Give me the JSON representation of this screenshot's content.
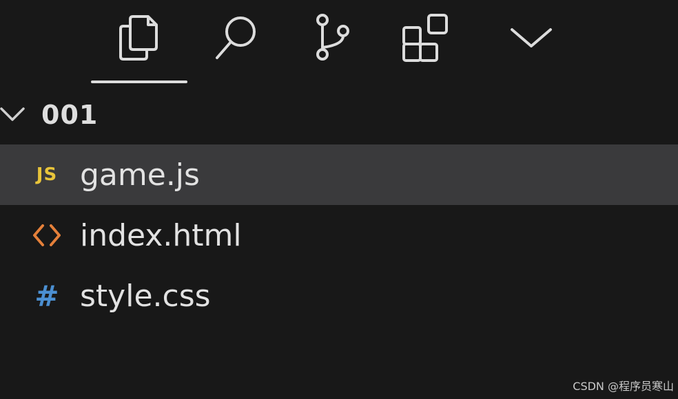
{
  "toolbar": {
    "tools": [
      {
        "id": "explorer",
        "icon": "files-icon",
        "active": true
      },
      {
        "id": "search",
        "icon": "search-icon",
        "active": false
      },
      {
        "id": "source-control",
        "icon": "source-control-icon",
        "active": false
      },
      {
        "id": "extensions",
        "icon": "extensions-icon",
        "active": false
      },
      {
        "id": "more",
        "icon": "chevron-down-icon",
        "active": false
      }
    ],
    "indicator_color": "#dcdcdc"
  },
  "explorer": {
    "folder": {
      "name": "001",
      "expanded": true
    },
    "files": [
      {
        "name": "game.js",
        "icon": "js-file-icon",
        "icon_text": "JS",
        "icon_color": "#e8c43a",
        "selected": true
      },
      {
        "name": "index.html",
        "icon": "html-file-icon",
        "icon_text": "",
        "icon_color": "#e5803a",
        "selected": false
      },
      {
        "name": "style.css",
        "icon": "css-file-icon",
        "icon_text": "#",
        "icon_color": "#4b8fd1",
        "selected": false
      }
    ]
  },
  "colors": {
    "background": "#181818",
    "selected_row": "#3a3a3c",
    "text": "#e2e2e2"
  },
  "watermark": "CSDN @程序员寒山"
}
